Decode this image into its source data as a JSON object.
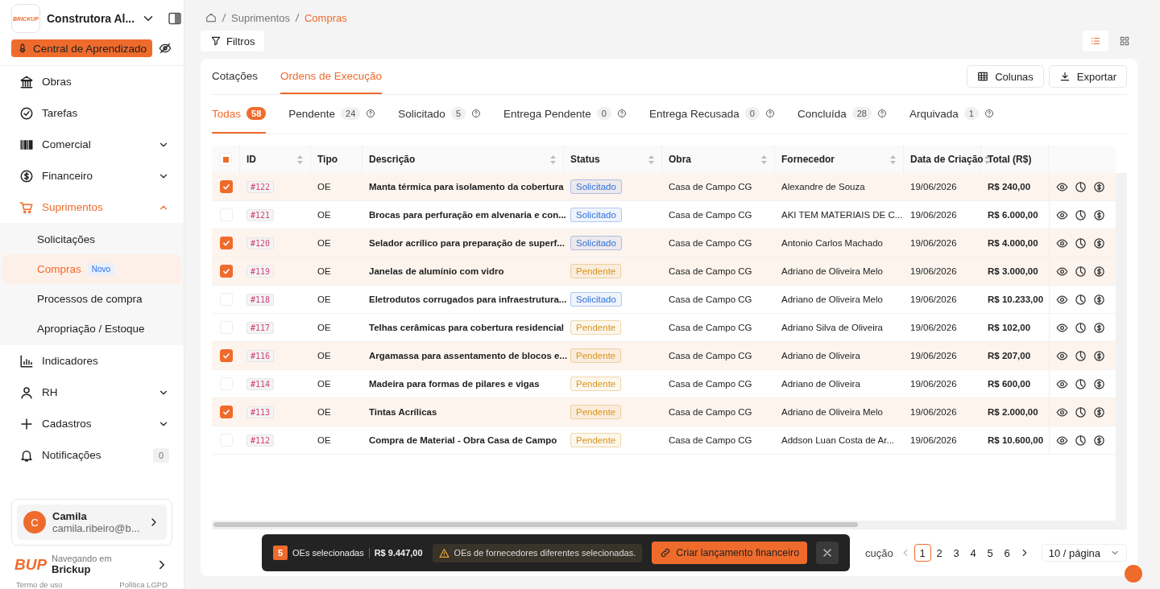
{
  "sidebar": {
    "logo_text": "BRICKUP",
    "company": "Construtora Al...",
    "learning_button": "Central de Aprendizado",
    "items": [
      {
        "label": "Obras",
        "selected": false
      },
      {
        "label": "Tarefas",
        "selected": false
      },
      {
        "label": "Comercial",
        "selected": false,
        "expanded": false
      },
      {
        "label": "Financeiro",
        "selected": false,
        "expanded": false
      },
      {
        "label": "Suprimentos",
        "selected": true,
        "expanded": true,
        "children": [
          {
            "label": "Solicitações",
            "selected": false
          },
          {
            "label": "Compras",
            "selected": true,
            "badge": "Novo"
          },
          {
            "label": "Processos de compra",
            "selected": false
          },
          {
            "label": "Apropriação / Estoque",
            "selected": false
          }
        ]
      },
      {
        "label": "Indicadores",
        "selected": false
      },
      {
        "label": "RH",
        "selected": false,
        "expanded": false
      },
      {
        "label": "Cadastros",
        "selected": false,
        "expanded": false
      },
      {
        "label": "Notificações",
        "selected": false,
        "count": "0"
      }
    ],
    "user": {
      "initial": "C",
      "name": "Camila",
      "email": "camila.ribeiro@b..."
    },
    "workspace": {
      "logo_text": "BUP",
      "caption": "Navegando em",
      "name": "Brickup"
    },
    "footer_links": [
      "Termo de uso",
      "Política LGPD"
    ]
  },
  "breadcrumb": [
    "Suprimentos",
    "Compras"
  ],
  "filter_button": "Filtros",
  "view_modes": [
    {
      "kind": "list",
      "selected": true
    },
    {
      "kind": "grid",
      "selected": false
    }
  ],
  "tabs": [
    {
      "label": "Cotações",
      "selected": false
    },
    {
      "label": "Ordens de Execução",
      "selected": true
    }
  ],
  "actions": [
    {
      "kind": "columns",
      "label": "Colunas"
    },
    {
      "kind": "export",
      "label": "Exportar"
    }
  ],
  "status_tabs": [
    {
      "label": "Todas",
      "count": "58",
      "selected": true
    },
    {
      "label": "Pendente",
      "count": "24",
      "selected": false
    },
    {
      "label": "Solicitado",
      "count": "5",
      "selected": false
    },
    {
      "label": "Entrega Pendente",
      "count": "0",
      "selected": false
    },
    {
      "label": "Entrega Recusada",
      "count": "0",
      "selected": false
    },
    {
      "label": "Concluída",
      "count": "28",
      "selected": false
    },
    {
      "label": "Arquivada",
      "count": "1",
      "selected": false
    }
  ],
  "table": {
    "select_all_indeterminate": true,
    "columns": [
      {
        "label": "ID",
        "sortable": true
      },
      {
        "label": "Tipo",
        "sortable": false
      },
      {
        "label": "Descrição",
        "sortable": true
      },
      {
        "label": "Status",
        "sortable": true
      },
      {
        "label": "Obra",
        "sortable": true
      },
      {
        "label": "Fornecedor",
        "sortable": true
      },
      {
        "label": "Data de Criação",
        "sortable": true
      },
      {
        "label": "Total (R$)",
        "sortable": false
      }
    ],
    "rows": [
      {
        "selected": true,
        "id": "#122",
        "tipo": "OE",
        "descricao": "Manta térmica para isolamento da cobertura",
        "status": {
          "label": "Solicitado",
          "color": "#2f6fdc"
        },
        "obra": "Casa de Campo CG",
        "fornecedor": "Alexandre de Souza",
        "data": "19/06/2026",
        "total": "R$ 240,00"
      },
      {
        "selected": false,
        "id": "#121",
        "tipo": "OE",
        "descricao": "Brocas para perfuração em alvenaria e con...",
        "status": {
          "label": "Solicitado",
          "color": "#2f6fdc"
        },
        "obra": "Casa de Campo CG",
        "fornecedor": "AKI TEM MATERIAIS DE C...",
        "data": "19/06/2026",
        "total": "R$ 6.000,00"
      },
      {
        "selected": true,
        "id": "#120",
        "tipo": "OE",
        "descricao": "Selador acrílico para preparação de superf...",
        "status": {
          "label": "Solicitado",
          "color": "#2f6fdc"
        },
        "obra": "Casa de Campo CG",
        "fornecedor": "Antonio Carlos Machado",
        "data": "19/06/2026",
        "total": "R$ 4.000,00"
      },
      {
        "selected": true,
        "id": "#119",
        "tipo": "OE",
        "descricao": "Janelas de alumínio com vidro",
        "status": {
          "label": "Pendente",
          "color": "#d9961a"
        },
        "obra": "Casa de Campo CG",
        "fornecedor": "Adriano de Oliveira Melo",
        "data": "19/06/2026",
        "total": "R$ 3.000,00"
      },
      {
        "selected": false,
        "id": "#118",
        "tipo": "OE",
        "descricao": "Eletrodutos corrugados para infraestrutura...",
        "status": {
          "label": "Solicitado",
          "color": "#2f6fdc"
        },
        "obra": "Casa de Campo CG",
        "fornecedor": "Adriano de Oliveira Melo",
        "data": "19/06/2026",
        "total": "R$ 10.233,00"
      },
      {
        "selected": false,
        "id": "#117",
        "tipo": "OE",
        "descricao": "Telhas cerâmicas para cobertura residencial",
        "status": {
          "label": "Pendente",
          "color": "#d9961a"
        },
        "obra": "Casa de Campo CG",
        "fornecedor": "Adriano Silva de Oliveira",
        "data": "19/06/2026",
        "total": "R$ 102,00"
      },
      {
        "selected": true,
        "id": "#116",
        "tipo": "OE",
        "descricao": "Argamassa para assentamento de blocos e...",
        "status": {
          "label": "Pendente",
          "color": "#d9961a"
        },
        "obra": "Casa de Campo CG",
        "fornecedor": "Adriano de Oliveira",
        "data": "19/06/2026",
        "total": "R$ 207,00"
      },
      {
        "selected": false,
        "id": "#114",
        "tipo": "OE",
        "descricao": "Madeira para formas de pilares e vigas",
        "status": {
          "label": "Pendente",
          "color": "#d9961a"
        },
        "obra": "Casa de Campo CG",
        "fornecedor": "Adriano de Oliveira",
        "data": "19/06/2026",
        "total": "R$ 600,00"
      },
      {
        "selected": true,
        "id": "#113",
        "tipo": "OE",
        "descricao": "Tintas Acrílicas",
        "status": {
          "label": "Pendente",
          "color": "#d9961a"
        },
        "obra": "Casa de Campo CG",
        "fornecedor": "Adriano de Oliveira Melo",
        "data": "19/06/2026",
        "total": "R$ 2.000,00"
      },
      {
        "selected": false,
        "id": "#112",
        "tipo": "OE",
        "descricao": "Compra de Material - Obra Casa de Campo",
        "status": {
          "label": "Pendente",
          "color": "#d9961a"
        },
        "obra": "Casa de Campo CG",
        "fornecedor": "Addson Luan Costa de Ar...",
        "data": "19/06/2026",
        "total": "R$ 10.600,00"
      }
    ]
  },
  "pagination": {
    "total_fragment": "cução",
    "pages": [
      {
        "label": "1",
        "selected": true
      },
      {
        "label": "2",
        "selected": false
      },
      {
        "label": "3",
        "selected": false
      },
      {
        "label": "4",
        "selected": false
      },
      {
        "label": "5",
        "selected": false
      },
      {
        "label": "6",
        "selected": false
      }
    ],
    "page_size": "10 / página"
  },
  "selection_bar": {
    "count": "5",
    "label": "OEs selecionadas",
    "total": "R$ 9.447,00",
    "warning": "OEs de fornecedores diferentes selecionadas.",
    "button": "Criar lançamento financeiro"
  }
}
